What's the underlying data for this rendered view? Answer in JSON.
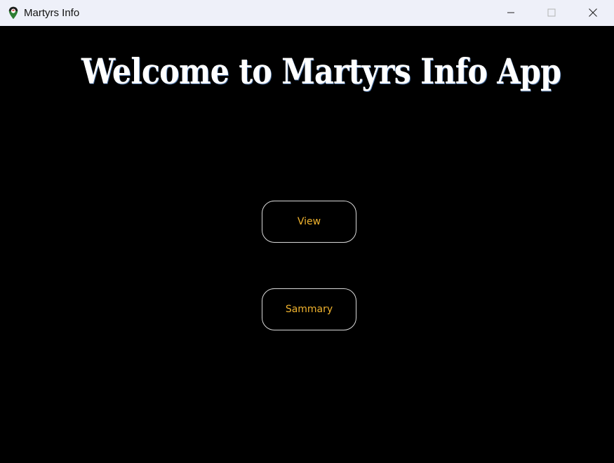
{
  "window": {
    "title": "Martyrs Info",
    "app_icon": "map-pin-icon",
    "controls": {
      "minimize_icon": "minimize-icon",
      "maximize_icon": "maximize-icon",
      "close_icon": "close-icon"
    }
  },
  "main": {
    "heading": "Welcome to Martyrs Info App",
    "buttons": {
      "view_label": "View",
      "summary_label": "Sammary"
    }
  },
  "colors": {
    "background": "#000000",
    "titlebar": "#eef0f9",
    "heading_text": "#ffffff",
    "button_text": "#f0b32e",
    "button_border": "#d9d9d9"
  }
}
